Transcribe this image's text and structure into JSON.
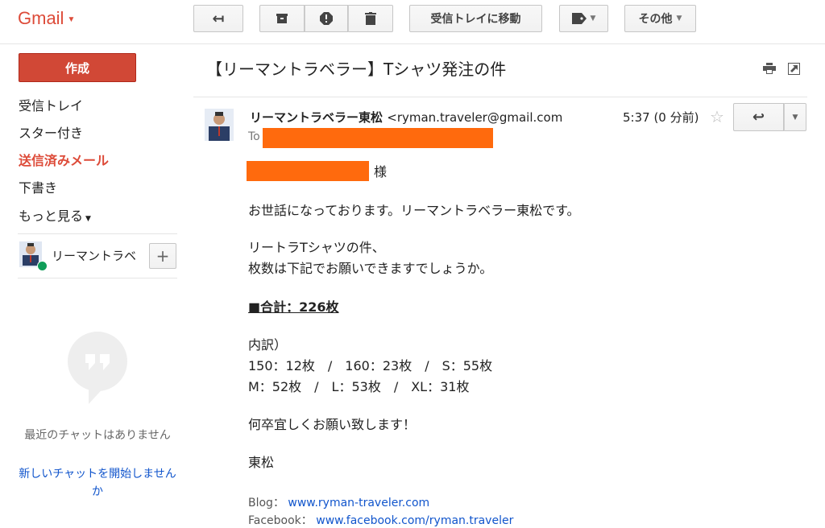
{
  "app": {
    "logo": "Gmail"
  },
  "toolbar": {
    "back_icon": "arrow-back-icon",
    "archive_icon": "archive-icon",
    "spam_icon": "report-spam-icon",
    "delete_icon": "trash-icon",
    "move_inbox_label": "受信トレイに移動",
    "label_icon": "label-tag-icon",
    "more_label": "その他"
  },
  "sidebar": {
    "compose_label": "作成",
    "items": [
      {
        "label": "受信トレイ"
      },
      {
        "label": "スター付き"
      },
      {
        "label": "送信済みメール",
        "active": true
      },
      {
        "label": "下書き"
      },
      {
        "label": "もっと見る"
      }
    ],
    "chat_user": "リーマントラベ",
    "chat_add": "+",
    "chat_empty": "最近のチャットはありません",
    "chat_start": "新しいチャットを開始しませんか"
  },
  "message": {
    "subject": "【リーマントラベラー】Tシャツ発注の件",
    "sender_name": "リーマントラベラー東松",
    "sender_email": "<ryman.traveler@gmail.com",
    "to_prefix": "To",
    "time": "5:37 (0 分前)",
    "salutation_suffix": "様",
    "greeting": "お世話になっております。リーマントラベラー東松です。",
    "para1_line1": "リートラTシャツの件、",
    "para1_line2": "枚数は下記でお願いできますでしょうか。",
    "total": "■合計：226枚",
    "breakdown_title": "内訳）",
    "breakdown_line1": "150：12枚　/　160：23枚　/　S：55枚",
    "breakdown_line2": "M：52枚　/　L：53枚　/　XL：31枚",
    "closing": "何卒宜しくお願い致します！",
    "signature_name": "東松",
    "blog_label": "Blog：",
    "blog_url": "www.ryman-traveler.com",
    "facebook_label": "Facebook：",
    "facebook_url": "www.facebook.com/ryman.traveler"
  },
  "colors": {
    "brand_red": "#dd4b39",
    "compose_red": "#d14836",
    "redaction": "#ff6a0d",
    "link": "#1155cc"
  }
}
